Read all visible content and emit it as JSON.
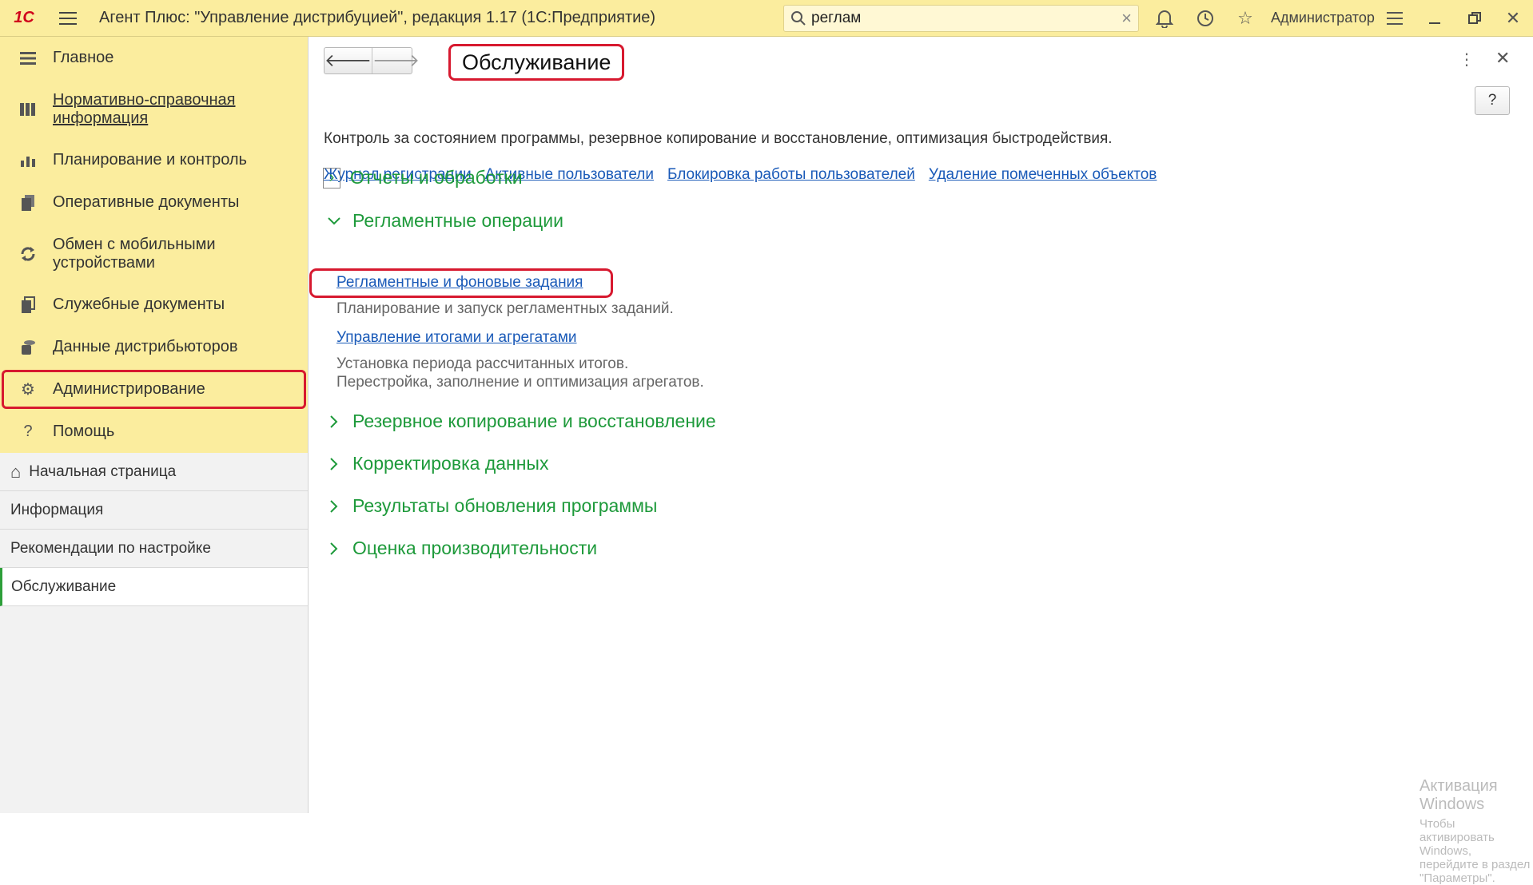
{
  "app": {
    "logo": "1С",
    "title": "Агент Плюс: \"Управление дистрибуцией\", редакция 1.17  (1С:Предприятие)",
    "search_value": "реглам",
    "user": "Администратор"
  },
  "sections": [
    {
      "label": "Главное",
      "icon": "list-icon"
    },
    {
      "label": "Нормативно-справочная информация",
      "icon": "book-icon"
    },
    {
      "label": "Планирование и контроль",
      "icon": "chart-icon"
    },
    {
      "label": "Оперативные документы",
      "icon": "documents-icon"
    },
    {
      "label": "Обмен с мобильными устройствами",
      "icon": "sync-icon"
    },
    {
      "label": "Служебные документы",
      "icon": "service-docs-icon"
    },
    {
      "label": "Данные дистрибьюторов",
      "icon": "database-icon"
    },
    {
      "label": "Администрирование",
      "icon": "gear-icon"
    },
    {
      "label": "Помощь",
      "icon": "help-icon"
    }
  ],
  "pages": [
    {
      "label": "Начальная страница"
    },
    {
      "label": "Информация"
    },
    {
      "label": "Рекомендации по настройке"
    },
    {
      "label": "Обслуживание"
    }
  ],
  "main": {
    "title": "Обслуживание",
    "help_label": "?",
    "description": "Контроль за состоянием программы, резервное копирование и восстановление, оптимизация быстродействия.",
    "links": [
      "Журнал регистрации",
      "Активные пользователи",
      "Блокировка работы пользователей",
      "Удаление помеченных объектов"
    ],
    "groups": {
      "reports": "Отчеты и обработки",
      "routine": "Регламентные операции",
      "backup": "Резервное копирование и восстановление",
      "correction": "Корректировка данных",
      "update_results": "Результаты обновления программы",
      "performance": "Оценка производительности"
    },
    "routine_items": [
      {
        "link": "Регламентные и фоновые задания",
        "desc": [
          "Планирование и запуск регламентных заданий."
        ]
      },
      {
        "link": "Управление итогами и агрегатами",
        "desc": [
          "Установка периода рассчитанных итогов.",
          "Перестройка, заполнение и оптимизация агрегатов."
        ]
      }
    ]
  },
  "watermark": {
    "line1": "Активация Windows",
    "line2": "Чтобы активировать Windows, перейдите в раздел \"Параметры\"."
  },
  "colors": {
    "top_bar": "#fbed9e",
    "group_green": "#1e9a3b",
    "link_blue": "#1a5ab8",
    "highlight_red": "#d7192f"
  }
}
